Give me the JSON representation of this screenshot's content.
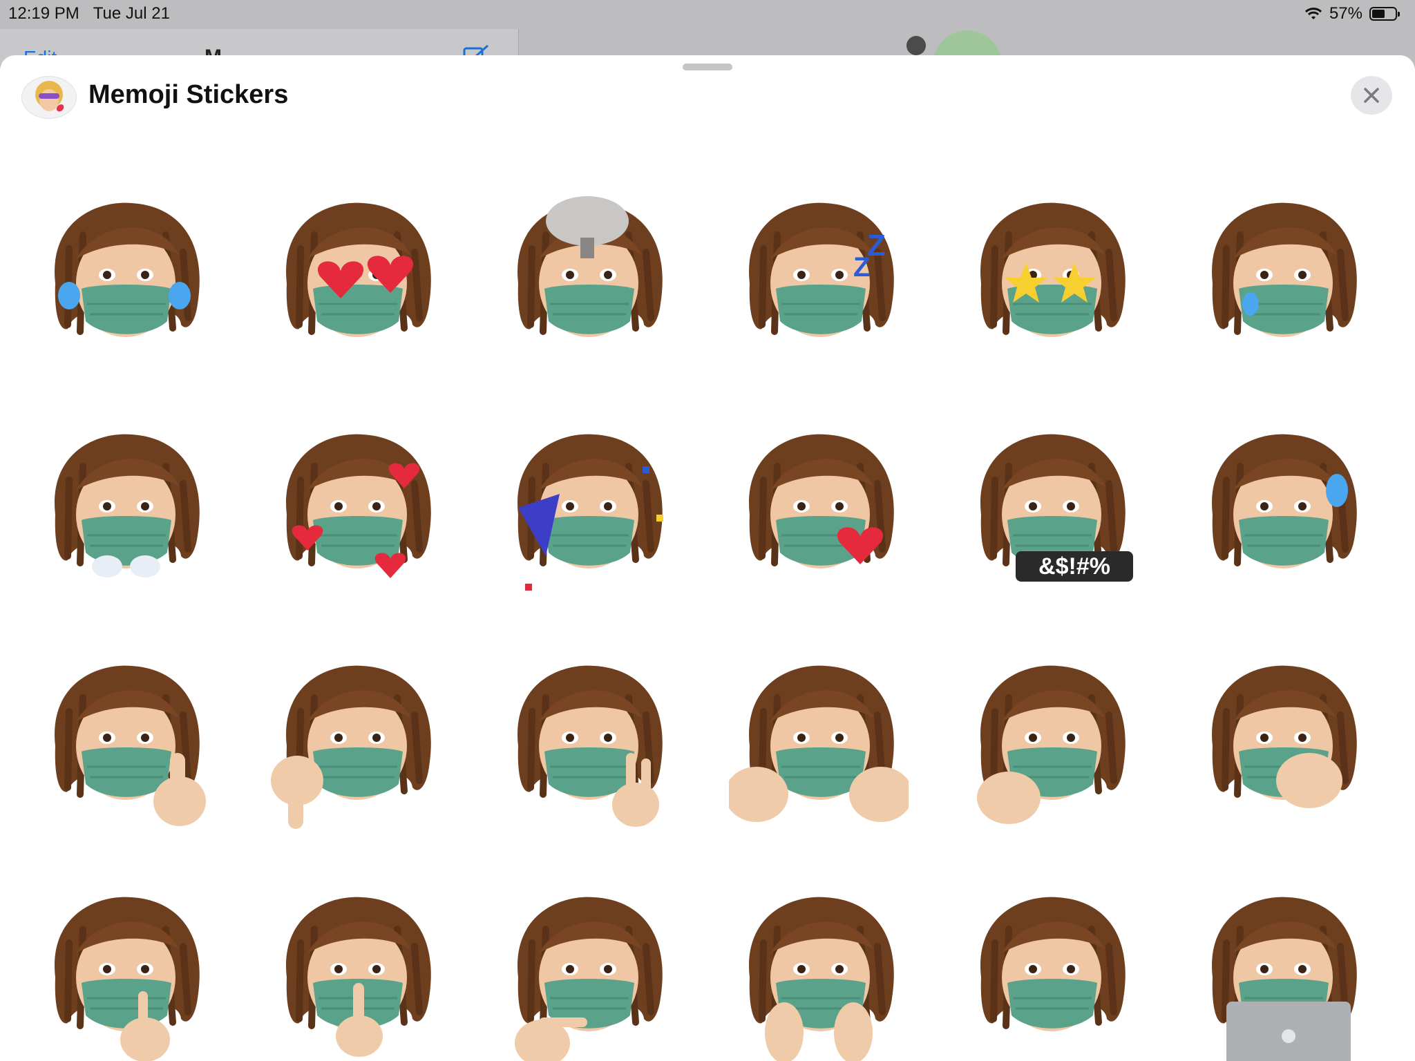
{
  "status_bar": {
    "time": "12:19 PM",
    "date": "Tue Jul 21",
    "battery": "57%",
    "battery_level": 0.57
  },
  "background_app": {
    "edit_label": "Edit",
    "title": "M"
  },
  "sheet": {
    "title": "Memoji Stickers",
    "close_icon": "close-icon"
  },
  "stickers": [
    {
      "name": "crying-tears",
      "extra": "tears"
    },
    {
      "name": "heart-eyes",
      "extra": "hearts"
    },
    {
      "name": "mind-blown",
      "extra": "explosion"
    },
    {
      "name": "sleeping",
      "extra": "zzz"
    },
    {
      "name": "star-struck",
      "extra": "stars"
    },
    {
      "name": "sad-tear",
      "extra": "tear"
    },
    {
      "name": "steam-nose",
      "extra": "steam"
    },
    {
      "name": "love-hearts",
      "extra": "hearts-small"
    },
    {
      "name": "party-horn",
      "extra": "confetti"
    },
    {
      "name": "wink-kiss",
      "extra": "heart-side"
    },
    {
      "name": "cursing",
      "extra": "caption",
      "caption": "&$!#%"
    },
    {
      "name": "sweat-drop",
      "extra": "drop"
    },
    {
      "name": "thumbs-up",
      "extra": "thumb-up"
    },
    {
      "name": "thumbs-down",
      "extra": "thumb-down"
    },
    {
      "name": "peace-sign",
      "extra": "peace"
    },
    {
      "name": "jazz-hands",
      "extra": "hands"
    },
    {
      "name": "fist-bump",
      "extra": "fist"
    },
    {
      "name": "hand-over-mouth",
      "extra": "hand-mouth"
    },
    {
      "name": "fingers-crossed",
      "extra": "crossed"
    },
    {
      "name": "shush",
      "extra": "finger-lips"
    },
    {
      "name": "thinking",
      "extra": "chin"
    },
    {
      "name": "face-in-hands",
      "extra": "cheeks"
    },
    {
      "name": "wink",
      "extra": "none"
    },
    {
      "name": "laptop",
      "extra": "laptop"
    }
  ]
}
